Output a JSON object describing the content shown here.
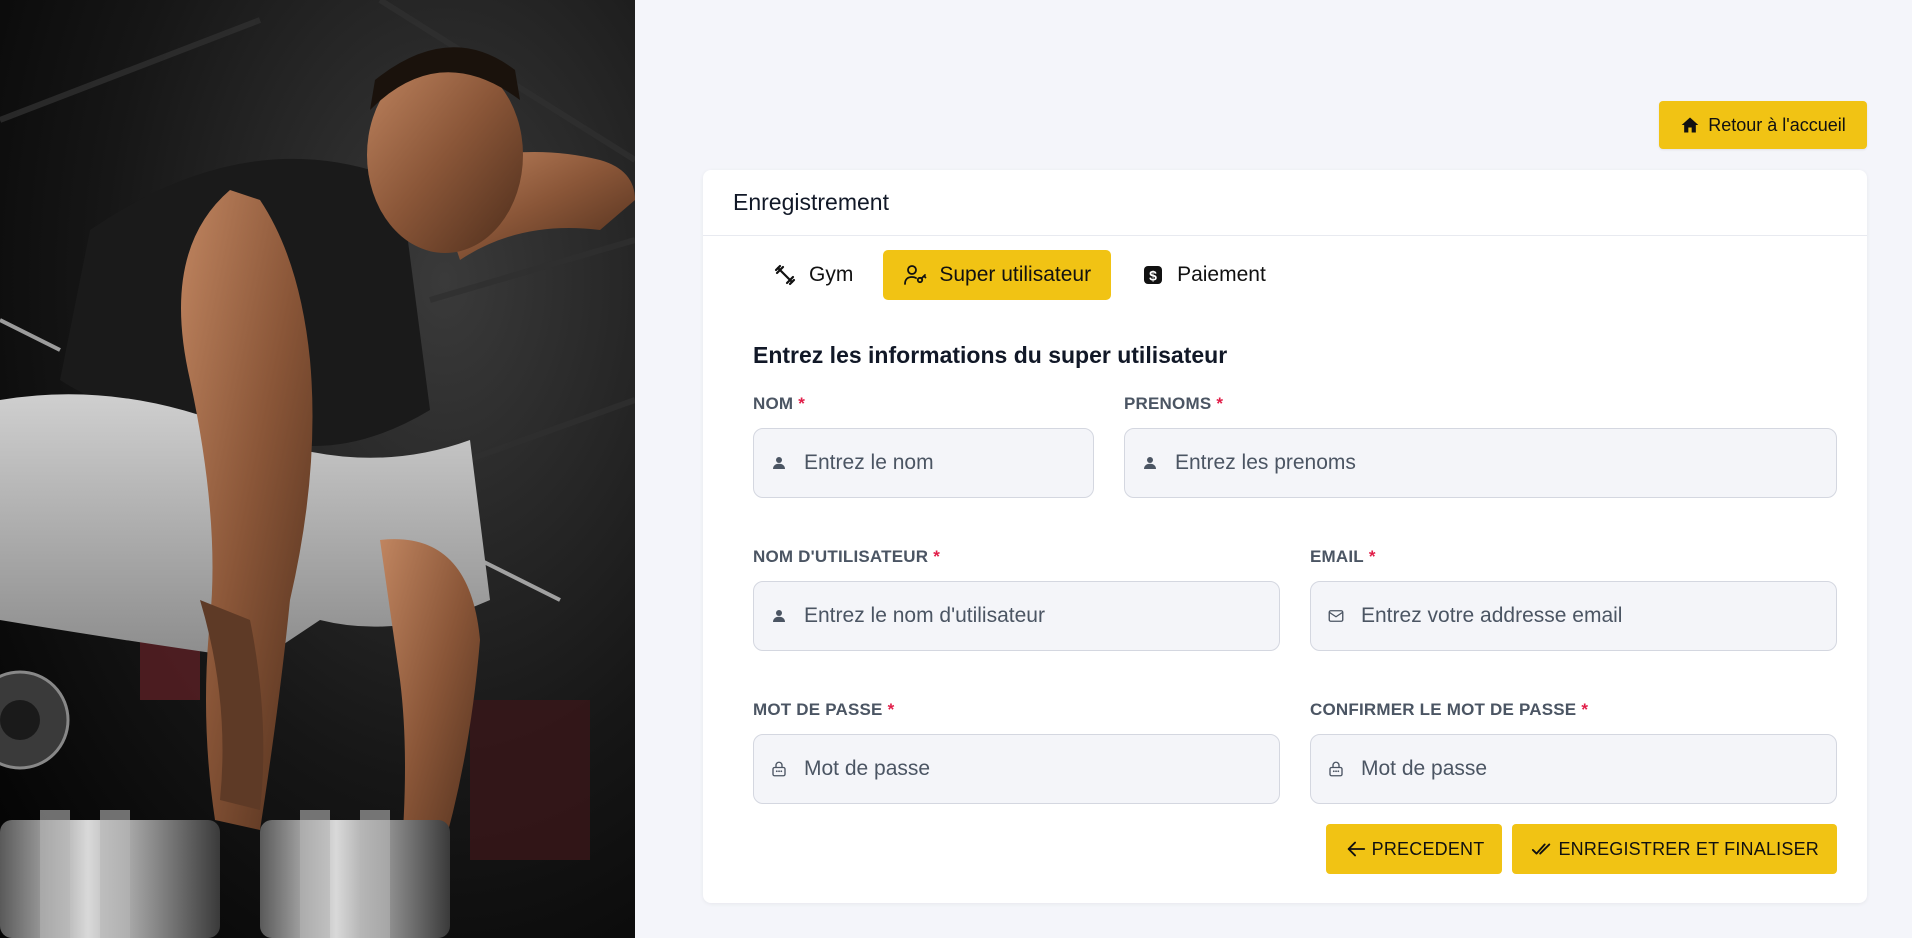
{
  "header": {
    "home_button_label": "Retour à l'accueil"
  },
  "card": {
    "title": "Enregistrement",
    "tabs": [
      {
        "label": "Gym",
        "icon": "dumbbell-icon",
        "active": false
      },
      {
        "label": "Super utilisateur",
        "icon": "user-key-icon",
        "active": true
      },
      {
        "label": "Paiement",
        "icon": "dollar-badge-icon",
        "active": false
      }
    ],
    "section_title": "Entrez les informations du super utilisateur",
    "fields": {
      "nom": {
        "label": "NOM",
        "required": "*",
        "placeholder": "Entrez le nom",
        "icon": "user-icon"
      },
      "prenoms": {
        "label": "PRENOMS",
        "required": "*",
        "placeholder": "Entrez les prenoms",
        "icon": "user-icon"
      },
      "username": {
        "label": "NOM D'UTILISATEUR",
        "required": "*",
        "placeholder": "Entrez le nom d'utilisateur",
        "icon": "user-icon"
      },
      "email": {
        "label": "EMAIL",
        "required": "*",
        "placeholder": "Entrez votre addresse email",
        "icon": "mail-icon"
      },
      "password": {
        "label": "MOT DE PASSE",
        "required": "*",
        "placeholder": "Mot de passe",
        "icon": "lock-icon"
      },
      "confirm": {
        "label": "CONFIRMER LE MOT DE PASSE",
        "required": "*",
        "placeholder": "Mot de passe",
        "icon": "lock-icon"
      }
    },
    "buttons": {
      "previous": "PRECEDENT",
      "finish": "ENREGISTRER ET FINALISER"
    }
  },
  "colors": {
    "accent": "#f1c314",
    "required": "#e11d48",
    "page_bg": "#f4f5fa"
  }
}
